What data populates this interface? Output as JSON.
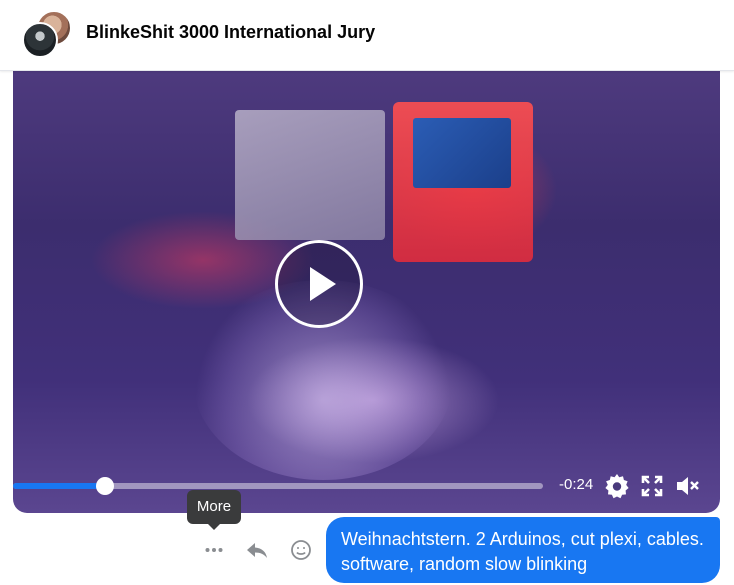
{
  "header": {
    "title": "BlinkeShit 3000 International Jury"
  },
  "video": {
    "time_remaining": "-0:24",
    "progress_fraction": 0.174,
    "controls": {
      "settings_icon": "gear-icon",
      "fullscreen_icon": "expand-icon",
      "volume_icon": "volume-muted-icon"
    }
  },
  "message_actions": {
    "tooltip": "More",
    "more_icon": "ellipsis-icon",
    "reply_icon": "reply-icon",
    "react_icon": "smiley-icon"
  },
  "message": {
    "text": "Weihnachtstern. 2 Arduinos, cut plexi, cables. software, random slow blinking"
  },
  "colors": {
    "accent": "#1877f2",
    "tooltip_bg": "#3a3b3c",
    "icon_gray": "#8a8d91"
  }
}
